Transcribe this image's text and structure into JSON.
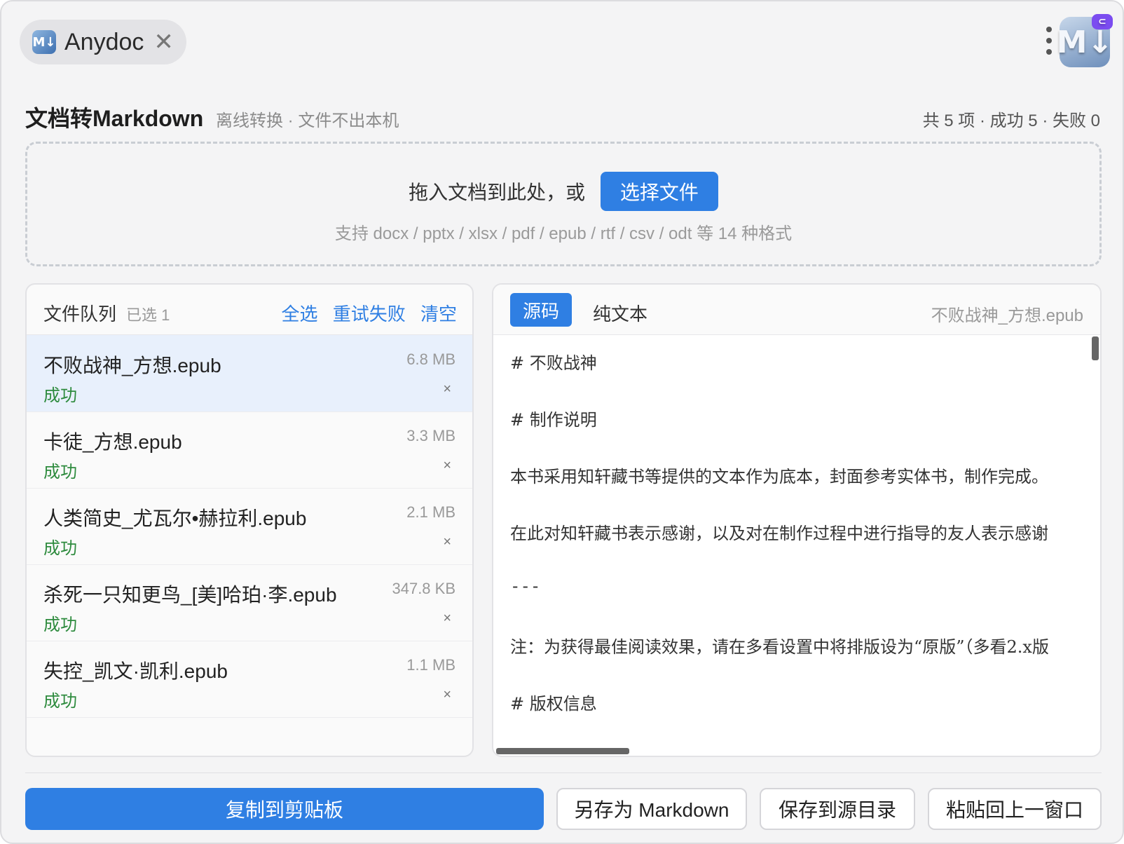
{
  "tab": {
    "title": "Anydoc",
    "logo_text": "M↓"
  },
  "app_icon": {
    "text": "M↓",
    "badge": "⊂"
  },
  "header": {
    "title": "文档转Markdown",
    "subtitle": "离线转换 · 文件不出本机",
    "stats": "共 5 项 · 成功 5 · 失败 0"
  },
  "dropzone": {
    "prompt": "拖入文档到此处，或",
    "button": "选择文件",
    "hint": "支持 docx / pptx / xlsx / pdf / epub / rtf / csv / odt 等 14 种格式"
  },
  "queue": {
    "title": "文件队列",
    "selected": "已选 1",
    "actions": {
      "select_all": "全选",
      "retry_failed": "重试失败",
      "clear": "清空"
    },
    "files": [
      {
        "name": "不败战神_方想.epub",
        "size": "6.8 MB",
        "status": "成功",
        "selected": true
      },
      {
        "name": "卡徒_方想.epub",
        "size": "3.3 MB",
        "status": "成功",
        "selected": false
      },
      {
        "name": "人类简史_尤瓦尔•赫拉利.epub",
        "size": "2.1 MB",
        "status": "成功",
        "selected": false
      },
      {
        "name": "杀死一只知更鸟_[美]哈珀·李.epub",
        "size": "347.8 KB",
        "status": "成功",
        "selected": false
      },
      {
        "name": "失控_凯文·凯利.epub",
        "size": "1.1 MB",
        "status": "成功",
        "selected": false
      }
    ],
    "remove_glyph": "×"
  },
  "preview": {
    "tabs": {
      "source": "源码",
      "plain": "纯文本"
    },
    "file": "不败战神_方想.epub",
    "lines": [
      "# 不败战神",
      "# 制作说明",
      "本书采用知轩藏书等提供的文本作为底本，封面参考实体书，制作完成。",
      "在此对知轩藏书表示感谢，以及对在制作过程中进行指导的友人表示感谢",
      "---",
      "注：为获得最佳阅读效果，请在多看设置中将排版设为“原版”（多看2.x版",
      "# 版权信息"
    ]
  },
  "footer": {
    "copy": "复制到剪贴板",
    "save_as": "另存为 Markdown",
    "save_to_source": "保存到源目录",
    "paste_back": "粘贴回上一窗口"
  },
  "colors": {
    "accent": "#2f7fe3",
    "success": "#2e8b3e",
    "selected_row": "#e8f0fc"
  }
}
